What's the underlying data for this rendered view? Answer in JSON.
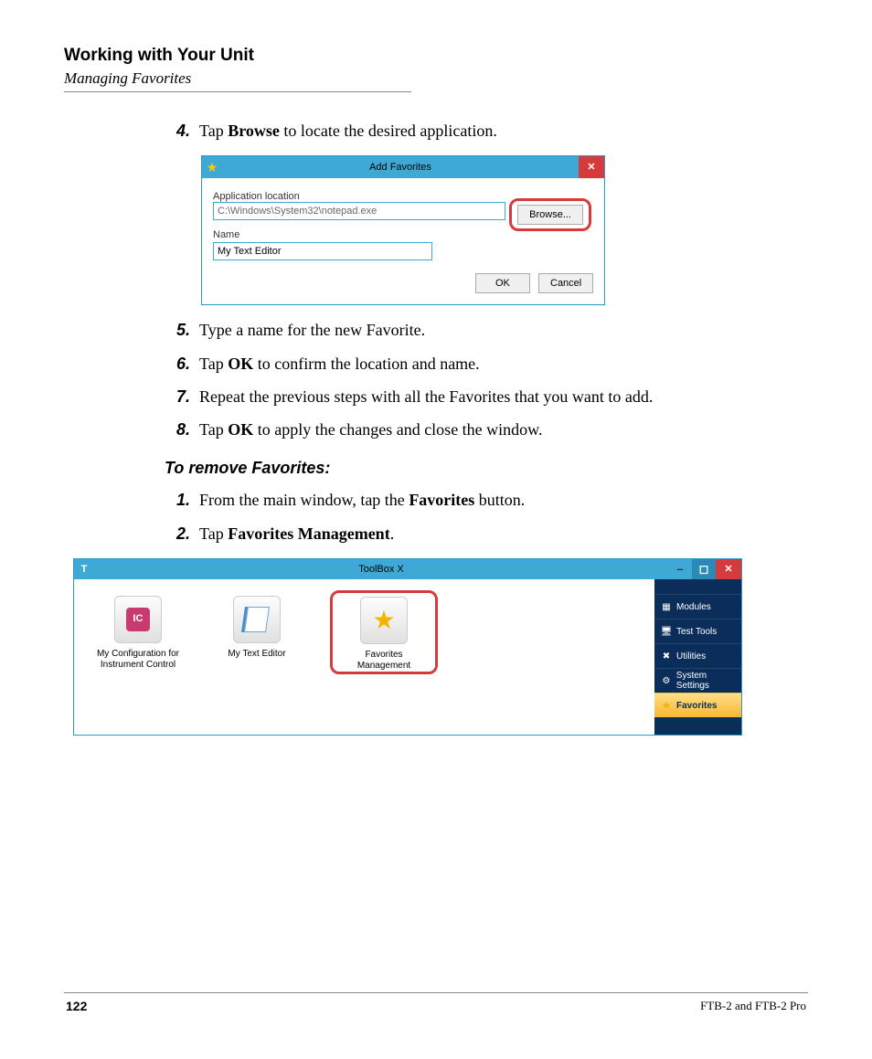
{
  "header": {
    "title": "Working with Your Unit",
    "subtitle": "Managing Favorites"
  },
  "steps_a": [
    {
      "n": "4.",
      "pre": "Tap ",
      "b": "Browse",
      "post": " to locate the desired application."
    }
  ],
  "dlg": {
    "title": "Add Favorites",
    "loc_label": "Application location",
    "loc_value": "C:\\Windows\\System32\\notepad.exe",
    "name_label": "Name",
    "name_value": "My Text Editor",
    "browse": "Browse...",
    "ok": "OK",
    "cancel": "Cancel"
  },
  "steps_b": [
    {
      "n": "5.",
      "pre": "Type a name for the new Favorite."
    },
    {
      "n": "6.",
      "pre": "Tap ",
      "b": "OK",
      "post": " to confirm the location and name."
    },
    {
      "n": "7.",
      "pre": "Repeat the previous steps with all the Favorites that you want to add."
    },
    {
      "n": "8.",
      "pre": "Tap ",
      "b": "OK",
      "post": " to apply the changes and close the window."
    }
  ],
  "remove_heading": "To remove Favorites:",
  "steps_c": [
    {
      "n": "1.",
      "pre": "From the main window, tap the ",
      "b": "Favorites",
      "post": " button."
    },
    {
      "n": "2.",
      "pre": "Tap ",
      "b": "Favorites Management",
      "post": "."
    }
  ],
  "tbx": {
    "title": "ToolBox X",
    "tiles": [
      {
        "label": "My Configuration for Instrument Control"
      },
      {
        "label": "My Text Editor"
      },
      {
        "label": "Favorites Management"
      }
    ],
    "side": [
      {
        "label": "Modules"
      },
      {
        "label": "Test Tools"
      },
      {
        "label": "Utilities"
      },
      {
        "label": "System Settings"
      },
      {
        "label": "Favorites"
      }
    ]
  },
  "footer": {
    "page": "122",
    "product": "FTB-2 and FTB-2 Pro"
  }
}
